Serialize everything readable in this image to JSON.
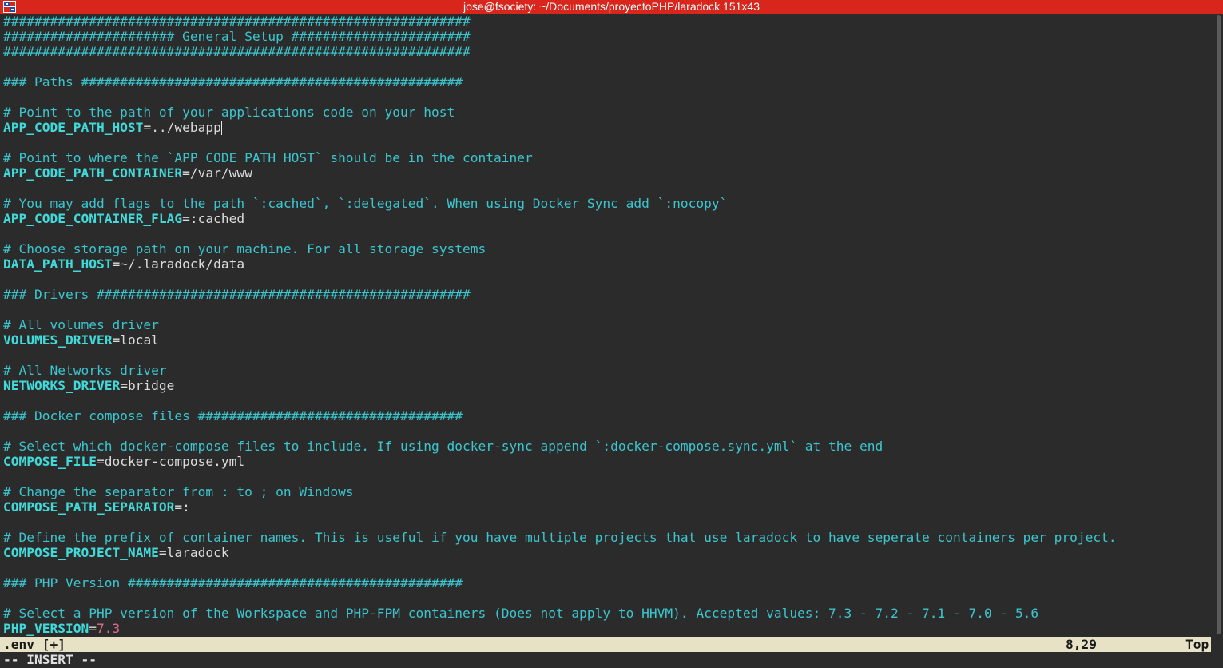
{
  "window": {
    "title": "jose@fsociety: ~/Documents/proyectoPHP/laradock 151x43",
    "icon": "terminal-icon"
  },
  "lines": [
    {
      "type": "comment",
      "text": "############################################################"
    },
    {
      "type": "comment",
      "text": "###################### General Setup #######################"
    },
    {
      "type": "comment",
      "text": "############################################################"
    },
    {
      "type": "blank",
      "text": ""
    },
    {
      "type": "comment",
      "text": "### Paths #################################################"
    },
    {
      "type": "blank",
      "text": ""
    },
    {
      "type": "comment",
      "text": "# Point to the path of your applications code on your host"
    },
    {
      "type": "kv",
      "key": "APP_CODE_PATH_HOST",
      "value": "../webapp",
      "cursor": true
    },
    {
      "type": "blank",
      "text": ""
    },
    {
      "type": "comment",
      "text": "# Point to where the `APP_CODE_PATH_HOST` should be in the container"
    },
    {
      "type": "kv",
      "key": "APP_CODE_PATH_CONTAINER",
      "value": "/var/www"
    },
    {
      "type": "blank",
      "text": ""
    },
    {
      "type": "comment",
      "text": "# You may add flags to the path `:cached`, `:delegated`. When using Docker Sync add `:nocopy`"
    },
    {
      "type": "kv",
      "key": "APP_CODE_CONTAINER_FLAG",
      "value": ":cached"
    },
    {
      "type": "blank",
      "text": ""
    },
    {
      "type": "comment",
      "text": "# Choose storage path on your machine. For all storage systems"
    },
    {
      "type": "kv",
      "key": "DATA_PATH_HOST",
      "value": "~/.laradock/data"
    },
    {
      "type": "blank",
      "text": ""
    },
    {
      "type": "comment",
      "text": "### Drivers ################################################"
    },
    {
      "type": "blank",
      "text": ""
    },
    {
      "type": "comment",
      "text": "# All volumes driver"
    },
    {
      "type": "kv",
      "key": "VOLUMES_DRIVER",
      "value": "local"
    },
    {
      "type": "blank",
      "text": ""
    },
    {
      "type": "comment",
      "text": "# All Networks driver"
    },
    {
      "type": "kv",
      "key": "NETWORKS_DRIVER",
      "value": "bridge"
    },
    {
      "type": "blank",
      "text": ""
    },
    {
      "type": "comment",
      "text": "### Docker compose files ##################################"
    },
    {
      "type": "blank",
      "text": ""
    },
    {
      "type": "comment",
      "text": "# Select which docker-compose files to include. If using docker-sync append `:docker-compose.sync.yml` at the end"
    },
    {
      "type": "kv",
      "key": "COMPOSE_FILE",
      "value": "docker-compose.yml"
    },
    {
      "type": "blank",
      "text": ""
    },
    {
      "type": "comment",
      "text": "# Change the separator from : to ; on Windows"
    },
    {
      "type": "kv",
      "key": "COMPOSE_PATH_SEPARATOR",
      "value": ":"
    },
    {
      "type": "blank",
      "text": ""
    },
    {
      "type": "comment",
      "text": "# Define the prefix of container names. This is useful if you have multiple projects that use laradock to have seperate containers per project."
    },
    {
      "type": "kv",
      "key": "COMPOSE_PROJECT_NAME",
      "value": "laradock"
    },
    {
      "type": "blank",
      "text": ""
    },
    {
      "type": "comment",
      "text": "### PHP Version ###########################################"
    },
    {
      "type": "blank",
      "text": ""
    },
    {
      "type": "comment",
      "text": "# Select a PHP version of the Workspace and PHP-FPM containers (Does not apply to HHVM). Accepted values: 7.3 - 7.2 - 7.1 - 7.0 - 5.6"
    },
    {
      "type": "kv",
      "key": "PHP_VERSION",
      "value": "7.3",
      "numeric": true
    }
  ],
  "status": {
    "file": ".env [+]",
    "position": "8,29",
    "scroll": "Top"
  },
  "mode": "-- INSERT --",
  "colors": {
    "background": "#2b2b2b",
    "comment": "#3bc6cf",
    "key": "#40dada",
    "value": "#dcdcdc",
    "number": "#e26e8a",
    "titlebar": "#d9261c",
    "statusline": "#e7e2c5"
  }
}
